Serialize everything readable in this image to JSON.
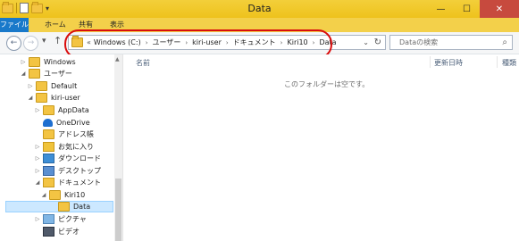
{
  "window": {
    "title": "Data",
    "min_glyph": "—",
    "max_glyph": "☐",
    "close_glyph": "✕"
  },
  "ribbon": {
    "tabs": [
      "ファイル",
      "ホーム",
      "共有",
      "表示"
    ]
  },
  "nav": {
    "back_glyph": "←",
    "forward_glyph": "→",
    "recent_glyph": "▾",
    "up_glyph": "↑"
  },
  "address": {
    "overflow": "«",
    "crumbs": [
      "Windows (C:)",
      "ユーザー",
      "kiri-user",
      "ドキュメント",
      "Kiri10",
      "Data"
    ],
    "separator": "›",
    "dropdown_glyph": "⌄",
    "refresh_glyph": "↻"
  },
  "search": {
    "placeholder": "Dataの検索",
    "icon_glyph": "⌕"
  },
  "tree": [
    {
      "label": "Windows",
      "icon": "folder-icon",
      "arrow": "▷"
    },
    {
      "label": "ユーザー",
      "icon": "folder-icon",
      "arrow": "◢"
    },
    {
      "label": "Default",
      "icon": "folder-icon",
      "arrow": "▷"
    },
    {
      "label": "kiri-user",
      "icon": "user-folder-icon",
      "arrow": "◢"
    },
    {
      "label": "AppData",
      "icon": "folder-icon",
      "arrow": "▷"
    },
    {
      "label": "OneDrive",
      "icon": "onedrive-icon",
      "arrow": ""
    },
    {
      "label": "アドレス帳",
      "icon": "contacts-icon",
      "arrow": ""
    },
    {
      "label": "お気に入り",
      "icon": "favorites-icon",
      "arrow": "▷"
    },
    {
      "label": "ダウンロード",
      "icon": "downloads-icon",
      "arrow": "▷"
    },
    {
      "label": "デスクトップ",
      "icon": "desktop-icon",
      "arrow": "▷"
    },
    {
      "label": "ドキュメント",
      "icon": "documents-icon",
      "arrow": "◢"
    },
    {
      "label": "Kiri10",
      "icon": "folder-icon",
      "arrow": "◢"
    },
    {
      "label": "Data",
      "icon": "folder-icon",
      "arrow": "",
      "selected": true
    },
    {
      "label": "ピクチャ",
      "icon": "pictures-icon",
      "arrow": "▷"
    },
    {
      "label": "ビデオ",
      "icon": "videos-icon",
      "arrow": ""
    }
  ],
  "columns": {
    "name": "名前",
    "modified": "更新日時",
    "type": "種類"
  },
  "content": {
    "empty_message": "このフォルダーは空です。"
  }
}
